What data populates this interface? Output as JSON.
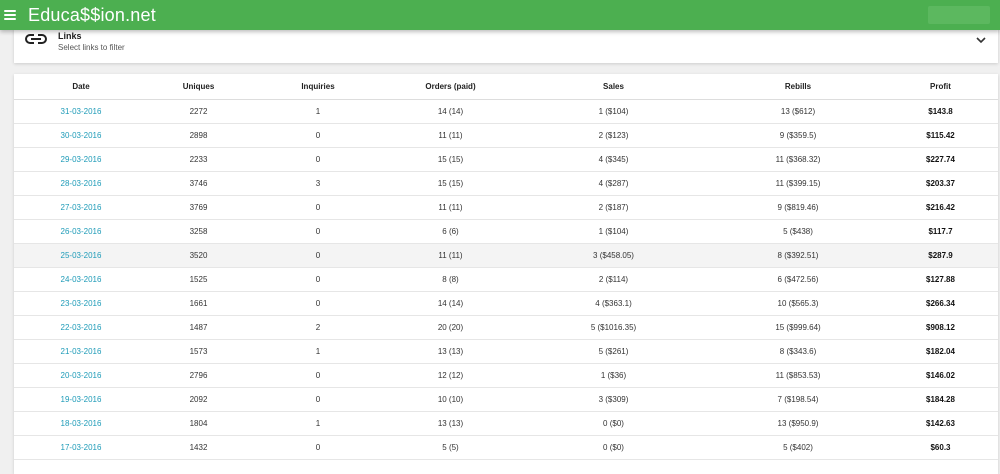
{
  "app": {
    "title": "Educa$$ion.net"
  },
  "filter": {
    "title": "Links",
    "subtitle": "Select links to filter"
  },
  "table": {
    "headers": [
      "Date",
      "Uniques",
      "Inquiries",
      "Orders (paid)",
      "Sales",
      "Rebills",
      "Profit"
    ],
    "rows": [
      [
        "31-03-2016",
        "2272",
        "1",
        "14 (14)",
        "1 ($104)",
        "13 ($612)",
        "$143.8"
      ],
      [
        "30-03-2016",
        "2898",
        "0",
        "11 (11)",
        "2 ($123)",
        "9 ($359.5)",
        "$115.42"
      ],
      [
        "29-03-2016",
        "2233",
        "0",
        "15 (15)",
        "4 ($345)",
        "11 ($368.32)",
        "$227.74"
      ],
      [
        "28-03-2016",
        "3746",
        "3",
        "15 (15)",
        "4 ($287)",
        "11 ($399.15)",
        "$203.37"
      ],
      [
        "27-03-2016",
        "3769",
        "0",
        "11 (11)",
        "2 ($187)",
        "9 ($819.46)",
        "$216.42"
      ],
      [
        "26-03-2016",
        "3258",
        "0",
        "6 (6)",
        "1 ($104)",
        "5 ($438)",
        "$117.7"
      ],
      [
        "25-03-2016",
        "3520",
        "0",
        "11 (11)",
        "3 ($458.05)",
        "8 ($392.51)",
        "$287.9"
      ],
      [
        "24-03-2016",
        "1525",
        "0",
        "8 (8)",
        "2 ($114)",
        "6 ($472.56)",
        "$127.88"
      ],
      [
        "23-03-2016",
        "1661",
        "0",
        "14 (14)",
        "4 ($363.1)",
        "10 ($565.3)",
        "$266.34"
      ],
      [
        "22-03-2016",
        "1487",
        "2",
        "20 (20)",
        "5 ($1016.35)",
        "15 ($999.64)",
        "$908.12"
      ],
      [
        "21-03-2016",
        "1573",
        "1",
        "13 (13)",
        "5 ($261)",
        "8 ($343.6)",
        "$182.04"
      ],
      [
        "20-03-2016",
        "2796",
        "0",
        "12 (12)",
        "1 ($36)",
        "11 ($853.53)",
        "$146.02"
      ],
      [
        "19-03-2016",
        "2092",
        "0",
        "10 (10)",
        "3 ($309)",
        "7 ($198.54)",
        "$184.28"
      ],
      [
        "18-03-2016",
        "1804",
        "1",
        "13 (13)",
        "0 ($0)",
        "13 ($950.9)",
        "$142.63"
      ],
      [
        "17-03-2016",
        "1432",
        "0",
        "5 (5)",
        "0 ($0)",
        "5 ($402)",
        "$60.3"
      ]
    ],
    "highlighted_row": 6
  },
  "colors": {
    "appbar": "#4caf50",
    "date_link": "#1e9bb8"
  }
}
